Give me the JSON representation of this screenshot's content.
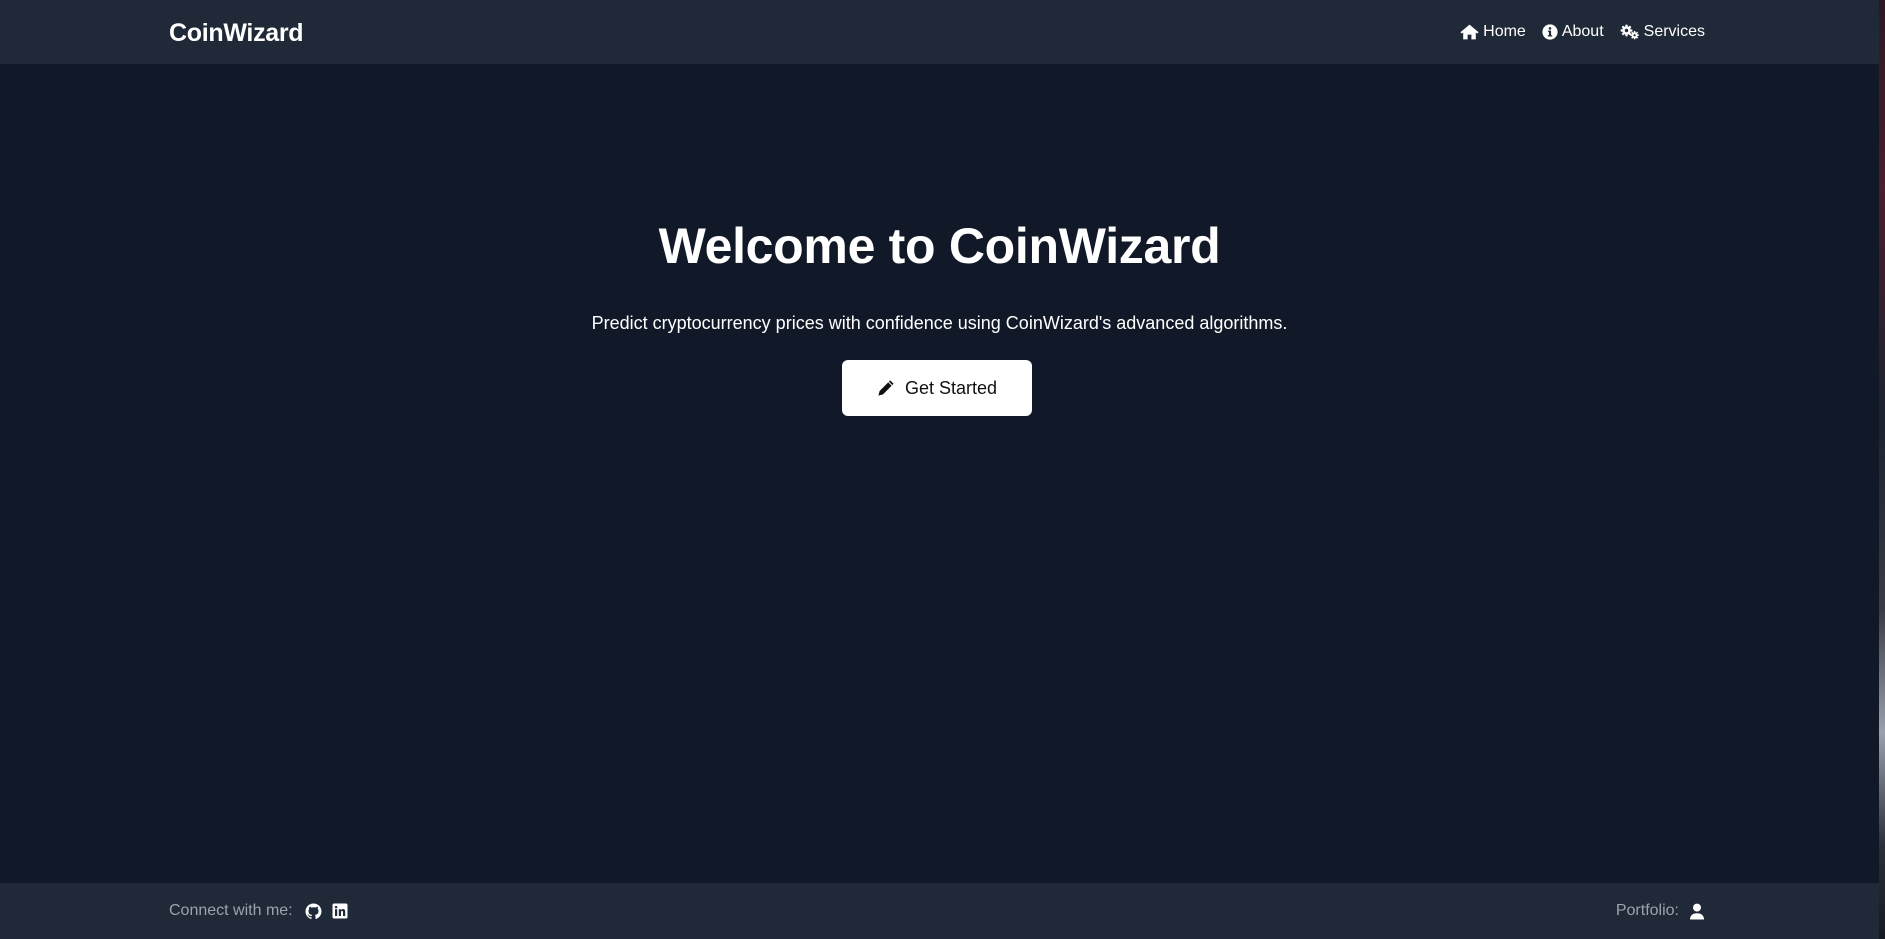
{
  "navbar": {
    "brand": "CoinWizard",
    "items": [
      {
        "label": "Home",
        "icon": "home-icon"
      },
      {
        "label": "About",
        "icon": "info-icon"
      },
      {
        "label": "Services",
        "icon": "gears-icon"
      }
    ]
  },
  "hero": {
    "title": "Welcome to CoinWizard",
    "subtitle": "Predict cryptocurrency prices with confidence using CoinWizard's advanced algorithms.",
    "cta_label": "Get Started",
    "cta_icon": "pencil-icon"
  },
  "footer": {
    "connect_label": "Connect with me:",
    "social_icons": [
      "github-icon",
      "linkedin-icon"
    ],
    "portfolio_label": "Portfolio:",
    "portfolio_icon": "user-icon"
  },
  "colors": {
    "background": "#111827",
    "bar": "#1f2937",
    "text": "#ffffff",
    "muted_text": "#9ca3af",
    "button_bg": "#ffffff",
    "button_text": "#111111"
  }
}
